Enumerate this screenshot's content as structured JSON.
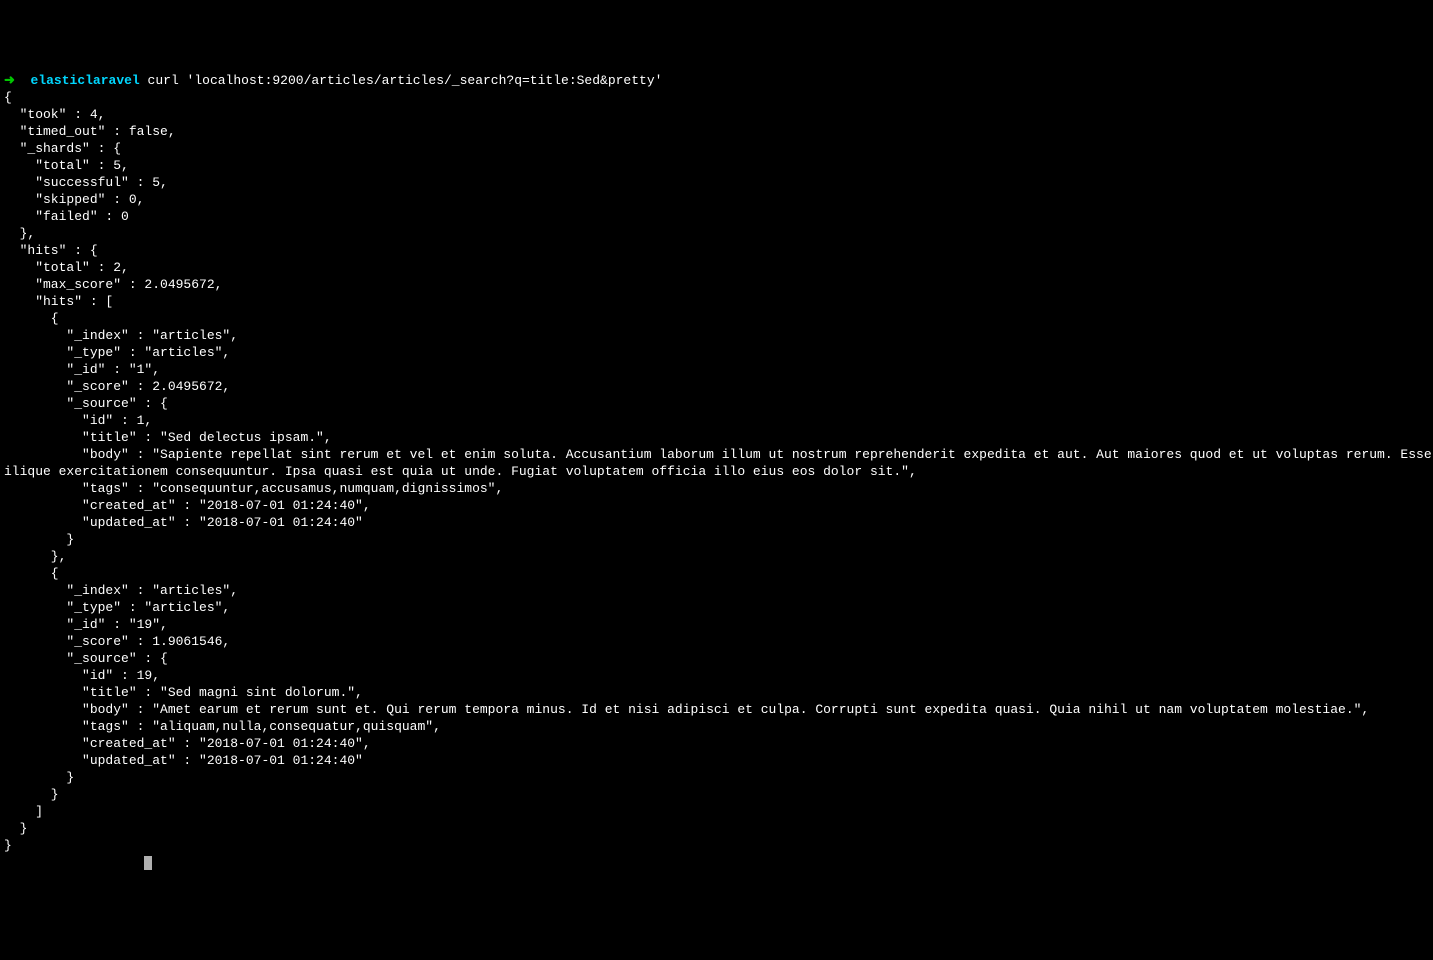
{
  "prompt": {
    "arrow": "➜",
    "path": "elasticlaravel",
    "command": "curl 'localhost:9200/articles/articles/_search?q=title:Sed&pretty'"
  },
  "json": {
    "line1": "{",
    "line2": "  \"took\" : 4,",
    "line3": "  \"timed_out\" : false,",
    "line4": "  \"_shards\" : {",
    "line5": "    \"total\" : 5,",
    "line6": "    \"successful\" : 5,",
    "line7": "    \"skipped\" : 0,",
    "line8": "    \"failed\" : 0",
    "line9": "  },",
    "line10": "  \"hits\" : {",
    "line11": "    \"total\" : 2,",
    "line12": "    \"max_score\" : 2.0495672,",
    "line13": "    \"hits\" : [",
    "line14": "      {",
    "line15": "        \"_index\" : \"articles\",",
    "line16": "        \"_type\" : \"articles\",",
    "line17": "        \"_id\" : \"1\",",
    "line18": "        \"_score\" : 2.0495672,",
    "line19": "        \"_source\" : {",
    "line20": "          \"id\" : 1,",
    "line21": "          \"title\" : \"Sed delectus ipsam.\",",
    "line22": "          \"body\" : \"Sapiente repellat sint rerum et vel et enim soluta. Accusantium laborum illum ut nostrum reprehenderit expedita et aut. Aut maiores quod et ut voluptas rerum. Esse laudantium optio sim",
    "line23": "ilique exercitationem consequuntur. Ipsa quasi est quia ut unde. Fugiat voluptatem officia illo eius eos dolor sit.\",",
    "line24": "          \"tags\" : \"consequuntur,accusamus,numquam,dignissimos\",",
    "line25": "          \"created_at\" : \"2018-07-01 01:24:40\",",
    "line26": "          \"updated_at\" : \"2018-07-01 01:24:40\"",
    "line27": "        }",
    "line28": "      },",
    "line29": "      {",
    "line30": "        \"_index\" : \"articles\",",
    "line31": "        \"_type\" : \"articles\",",
    "line32": "        \"_id\" : \"19\",",
    "line33": "        \"_score\" : 1.9061546,",
    "line34": "        \"_source\" : {",
    "line35": "          \"id\" : 19,",
    "line36": "          \"title\" : \"Sed magni sint dolorum.\",",
    "line37": "          \"body\" : \"Amet earum et rerum sunt et. Qui rerum tempora minus. Id et nisi adipisci et culpa. Corrupti sunt expedita quasi. Quia nihil ut nam voluptatem molestiae.\",",
    "line38": "          \"tags\" : \"aliquam,nulla,consequatur,quisquam\",",
    "line39": "          \"created_at\" : \"2018-07-01 01:24:40\",",
    "line40": "          \"updated_at\" : \"2018-07-01 01:24:40\"",
    "line41": "        }",
    "line42": "      }",
    "line43": "    ]",
    "line44": "  }",
    "line45": "}"
  }
}
